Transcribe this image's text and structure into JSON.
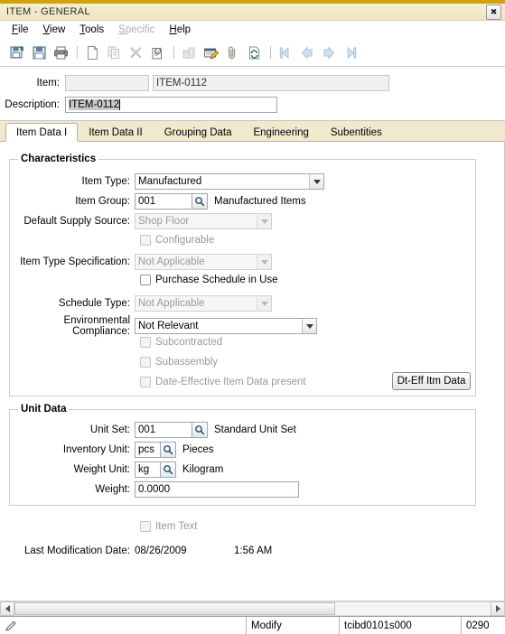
{
  "window": {
    "title": "ITEM - GENERAL",
    "close_label": "✖"
  },
  "menu": [
    {
      "label": "File",
      "disabled": false
    },
    {
      "label": "View",
      "disabled": false
    },
    {
      "label": "Tools",
      "disabled": false
    },
    {
      "label": "Specific",
      "disabled": true
    },
    {
      "label": "Help",
      "disabled": false
    }
  ],
  "toolbar": {
    "icons": [
      "save-and-new-icon",
      "save-icon",
      "print-icon",
      "separator",
      "new-document-icon",
      "copy-icon",
      "delete-icon",
      "properties-icon",
      "separator",
      "company-icon",
      "notes-icon",
      "attachment-icon",
      "refresh-icon",
      "separator",
      "first-record-icon",
      "previous-record-icon",
      "next-record-icon",
      "last-record-icon"
    ]
  },
  "header": {
    "item_label": "Item:",
    "item_code": "",
    "item_code_display": "ITEM-0112",
    "description_label": "Description:",
    "description_value": "ITEM-0112"
  },
  "tabs": [
    {
      "label": "Item Data I",
      "active": true
    },
    {
      "label": "Item Data II",
      "active": false
    },
    {
      "label": "Grouping Data",
      "active": false
    },
    {
      "label": "Engineering",
      "active": false
    },
    {
      "label": "Subentities",
      "active": false
    }
  ],
  "characteristics": {
    "group_title": "Characteristics",
    "item_type": {
      "label": "Item Type:",
      "value": "Manufactured",
      "disabled": false
    },
    "item_group": {
      "label": "Item Group:",
      "value": "001",
      "description": "Manufactured Items",
      "lookup_icon": "search-icon"
    },
    "default_supply_source": {
      "label": "Default Supply Source:",
      "value": "Shop Floor",
      "disabled": true
    },
    "configurable": {
      "label": "Configurable",
      "checked": false,
      "disabled": true
    },
    "item_type_specification": {
      "label": "Item Type Specification:",
      "value": "Not Applicable",
      "disabled": true
    },
    "purchase_schedule_in_use": {
      "label": "Purchase Schedule in Use",
      "checked": false,
      "disabled": false
    },
    "schedule_type": {
      "label": "Schedule Type:",
      "value": "Not Applicable",
      "disabled": true
    },
    "environmental_compliance": {
      "label": "Environmental Compliance:",
      "value": "Not Relevant",
      "disabled": false
    },
    "subcontracted": {
      "label": "Subcontracted",
      "checked": false,
      "disabled": true
    },
    "subassembly": {
      "label": "Subassembly",
      "checked": false,
      "disabled": true
    },
    "date_effective": {
      "label": "Date-Effective Item Data present",
      "checked": false,
      "disabled": true
    },
    "dt_eff_button": "Dt-Eff Itm Data"
  },
  "unit_data": {
    "group_title": "Unit Data",
    "unit_set": {
      "label": "Unit Set:",
      "value": "001",
      "description": "Standard Unit Set",
      "lookup_icon": "search-icon"
    },
    "inventory_unit": {
      "label": "Inventory Unit:",
      "value": "pcs",
      "description": "Pieces",
      "lookup_icon": "search-icon"
    },
    "weight_unit": {
      "label": "Weight Unit:",
      "value": "kg",
      "description": "Kilogram",
      "lookup_icon": "search-icon"
    },
    "weight": {
      "label": "Weight:",
      "value": "0.0000"
    }
  },
  "footer": {
    "item_text": {
      "label": "Item Text",
      "checked": false,
      "disabled": true
    },
    "last_modification_label": "Last Modification Date:",
    "last_modification_date": "08/26/2009",
    "last_modification_time": "1:56 AM"
  },
  "statusbar": {
    "mode_icon": "pencil-icon",
    "mode": "Modify",
    "session": "tcibd0101s000",
    "code": "0290"
  },
  "colors": {
    "title_gold": "#d2a206",
    "title_cream": "#f1e8cb",
    "tab_strip": "#f1e9ce"
  }
}
